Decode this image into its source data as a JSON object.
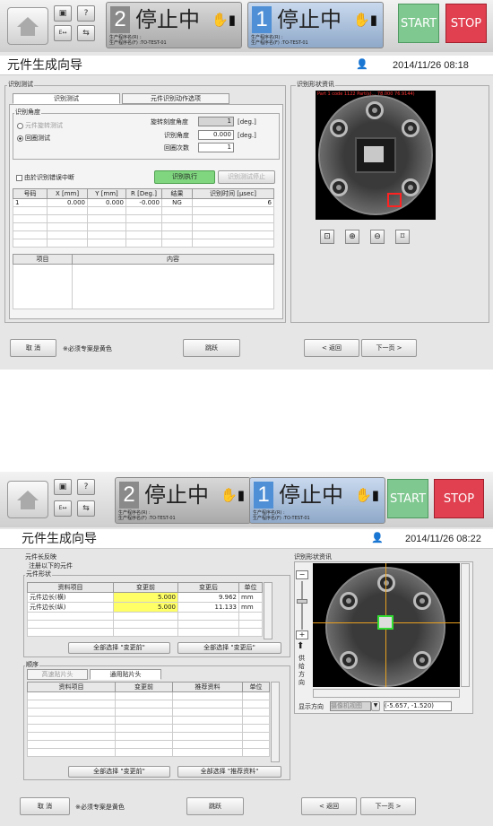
{
  "screen1": {
    "panel2": {
      "num": "2",
      "status": "停止中",
      "prog_name_r": "生产程序名(R) :",
      "prog_name_f": "生产程序名(F) :TO-TEST-01"
    },
    "panel1": {
      "num": "1",
      "status": "停止中",
      "prog_name_r": "生产程序名(R) :",
      "prog_name_f": "生产程序名(F) :TO-TEST-01"
    },
    "start": "START",
    "stop": "STOP",
    "title": "元件生成向导",
    "datetime": "2014/11/26 08:18",
    "group_label": "识别测试",
    "tabs": [
      "识别测试",
      "元件识别动作选项"
    ],
    "angle_group": "识别角度",
    "radio_rotate": "元件旋转测试",
    "radio_loop": "回圈测试",
    "rot_label": "旋转刻度角度",
    "rot_value": "1",
    "unit_deg": "[deg.]",
    "angle_label": "识别角度",
    "angle_value": "0.000",
    "loop_label": "回圈次数",
    "loop_value": "1",
    "chk_interrupt": "由於识别错误中断",
    "btn_exec": "识别执行",
    "btn_stop": "识别测试停止",
    "result_headers": [
      "号码",
      "X [mm]",
      "Y [mm]",
      "R [Deg.]",
      "结果",
      "识别时间 [μsec]"
    ],
    "result_rows": [
      [
        "1",
        "0.000",
        "0.000",
        "-0.000",
        "NG",
        "6"
      ]
    ],
    "detail_headers": [
      "项目",
      "内容"
    ],
    "shape_label": "识别形状资讯",
    "overlay_text": "Part 1 code 1122 Part(s)...  78.000 76.9144)",
    "cancel": "取 消",
    "required_note": "※必须专案是黄色",
    "skip": "跳跃",
    "back": "< 返回",
    "next": "下一页 >"
  },
  "screen2": {
    "panel2": {
      "num": "2",
      "status": "停止中",
      "prog_name_r": "生产程序名(R) :",
      "prog_name_f": "生产程序名(F) :TO-TEST-01"
    },
    "panel1": {
      "num": "1",
      "status": "停止中",
      "prog_name_r": "生产程序名(R) :",
      "prog_name_f": "生产程序名(F) :TO-TEST-01"
    },
    "start": "START",
    "stop": "STOP",
    "title": "元件生成向导",
    "datetime": "2014/11/26 08:22",
    "feedback_label": "元件长反映",
    "note": "注册以下的元件",
    "shape_group": "元件形状",
    "shape_headers": [
      "资料项目",
      "变更前",
      "变更后",
      "单位"
    ],
    "shape_rows": [
      [
        "元件边长(横)",
        "5.000",
        "9.962",
        "mm"
      ],
      [
        "元件边长(纵)",
        "5.000",
        "11.133",
        "mm"
      ]
    ],
    "select_before": "全部选择 \"变更前\"",
    "select_after": "全部选择 \"变更后\"",
    "order_label": "顺序",
    "tabs": [
      "高速贴片头",
      "通用贴片头"
    ],
    "order_headers": [
      "资料项目",
      "变更前",
      "推荐资料",
      "单位"
    ],
    "select_before2": "全部选择 \"变更前\"",
    "select_recommended": "全部选择 \"推荐资料\"",
    "shape_info": "识别形状资讯",
    "supply_dir": [
      "供",
      "给",
      "方",
      "向"
    ],
    "display_dir_label": "显示方向",
    "display_dir_value": "摄像机视图",
    "coords": "(-5.657, -1.520)",
    "cancel": "取 消",
    "required_note": "※必须专案是黄色",
    "skip": "跳跃",
    "back": "< 返回",
    "next": "下一页 >"
  },
  "colors": {
    "start": "#7fc890",
    "stop": "#e04050",
    "exec": "#7fd67f",
    "required": "#ffff66"
  }
}
